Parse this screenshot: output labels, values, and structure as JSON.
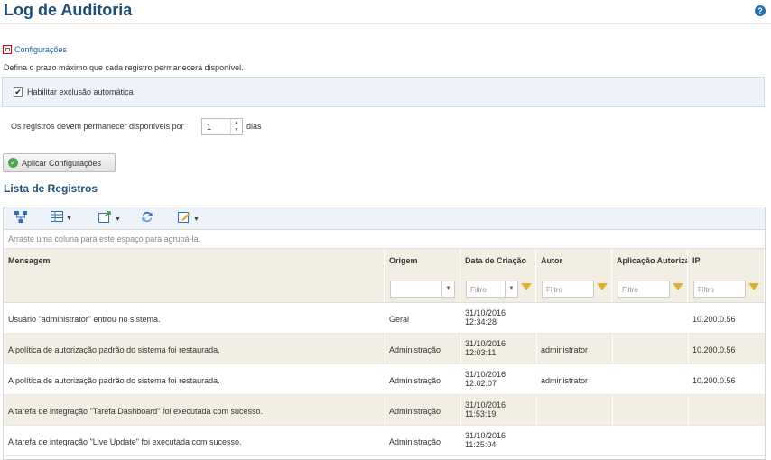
{
  "page": {
    "title": "Log de Auditoria",
    "help_icon": "?"
  },
  "settings": {
    "toggle_label": "Configurações",
    "description": "Defina o prazo máximo que cada registro permanecerá disponível.",
    "auto_delete": {
      "label": "Habilitar exclusão automática",
      "checked": true
    },
    "retention": {
      "prefix": "Os registros devem permanecer disponíveis por",
      "value": "1",
      "unit": "dias"
    },
    "apply_button": "Aplicar Configurações"
  },
  "list": {
    "title": "Lista de Registros",
    "toolbar": [
      "hierarchy-icon",
      "columns-icon",
      "export-icon",
      "refresh-icon",
      "edit-icon"
    ],
    "group_hint": "Arraste uma coluna para este espaço para agrupá-la.",
    "columns": [
      "Mensagem",
      "Origem",
      "Data de Criação",
      "Autor",
      "Aplicação Autorizada",
      "IP"
    ],
    "filter_placeholder": "Filtro",
    "rows": [
      {
        "message": "Usuário \"administrator\" entrou no sistema.",
        "origin": "Geral",
        "date": "31/10/2016",
        "time": "12:34:28",
        "author": "",
        "app": "",
        "ip": "10.200.0.56"
      },
      {
        "message": "A política de autorização padrão do sistema foi restaurada.",
        "origin": "Administração",
        "date": "31/10/2016",
        "time": "12:03:11",
        "author": "administrator",
        "app": "",
        "ip": "10.200.0.56"
      },
      {
        "message": "A política de autorização padrão do sistema foi restaurada.",
        "origin": "Administração",
        "date": "31/10/2016",
        "time": "12:02:07",
        "author": "administrator",
        "app": "",
        "ip": "10.200.0.56"
      },
      {
        "message": "A tarefa de integração \"Tarefa Dashboard\" foi executada com sucesso.",
        "origin": "Administração",
        "date": "31/10/2016",
        "time": "11:53:19",
        "author": "",
        "app": "",
        "ip": ""
      },
      {
        "message": "A tarefa de integração \"Live Update\" foi executada com sucesso.",
        "origin": "Administração",
        "date": "31/10/2016",
        "time": "11:25:04",
        "author": "",
        "app": "",
        "ip": ""
      }
    ]
  }
}
